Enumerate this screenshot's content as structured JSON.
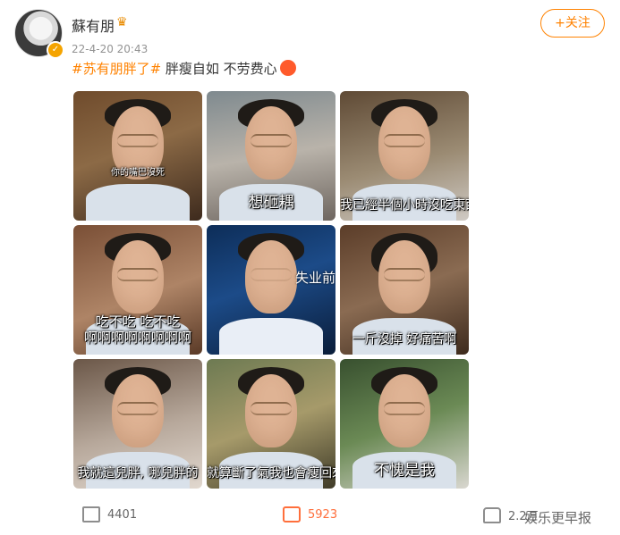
{
  "post": {
    "username": "蘇有朋",
    "timestamp": "22-4-20 20:43",
    "follow_label": "+关注",
    "hashtag": "#苏有朋胖了#",
    "text": " 胖瘦自如 不劳费心"
  },
  "images": [
    {
      "caption": "你的嘴巴沒死"
    },
    {
      "caption": "想砸耦"
    },
    {
      "caption": "我已經半個小時沒吃東西了"
    },
    {
      "caption": "吃不吃 吃不吃\n啊啊啊啊啊啊啊啊"
    },
    {
      "caption": "",
      "side_text": "失业前"
    },
    {
      "caption": "一斤沒掉 好痛苦啊"
    },
    {
      "caption": "我就這兒胖, 哪兒胖的"
    },
    {
      "caption": "就算斷了氣我也會瘦回來的"
    },
    {
      "caption": "不愧是我"
    }
  ],
  "actions": {
    "repost": "4401",
    "comment": "5923",
    "like": "2.2万"
  },
  "watermark": "娱乐更早报"
}
